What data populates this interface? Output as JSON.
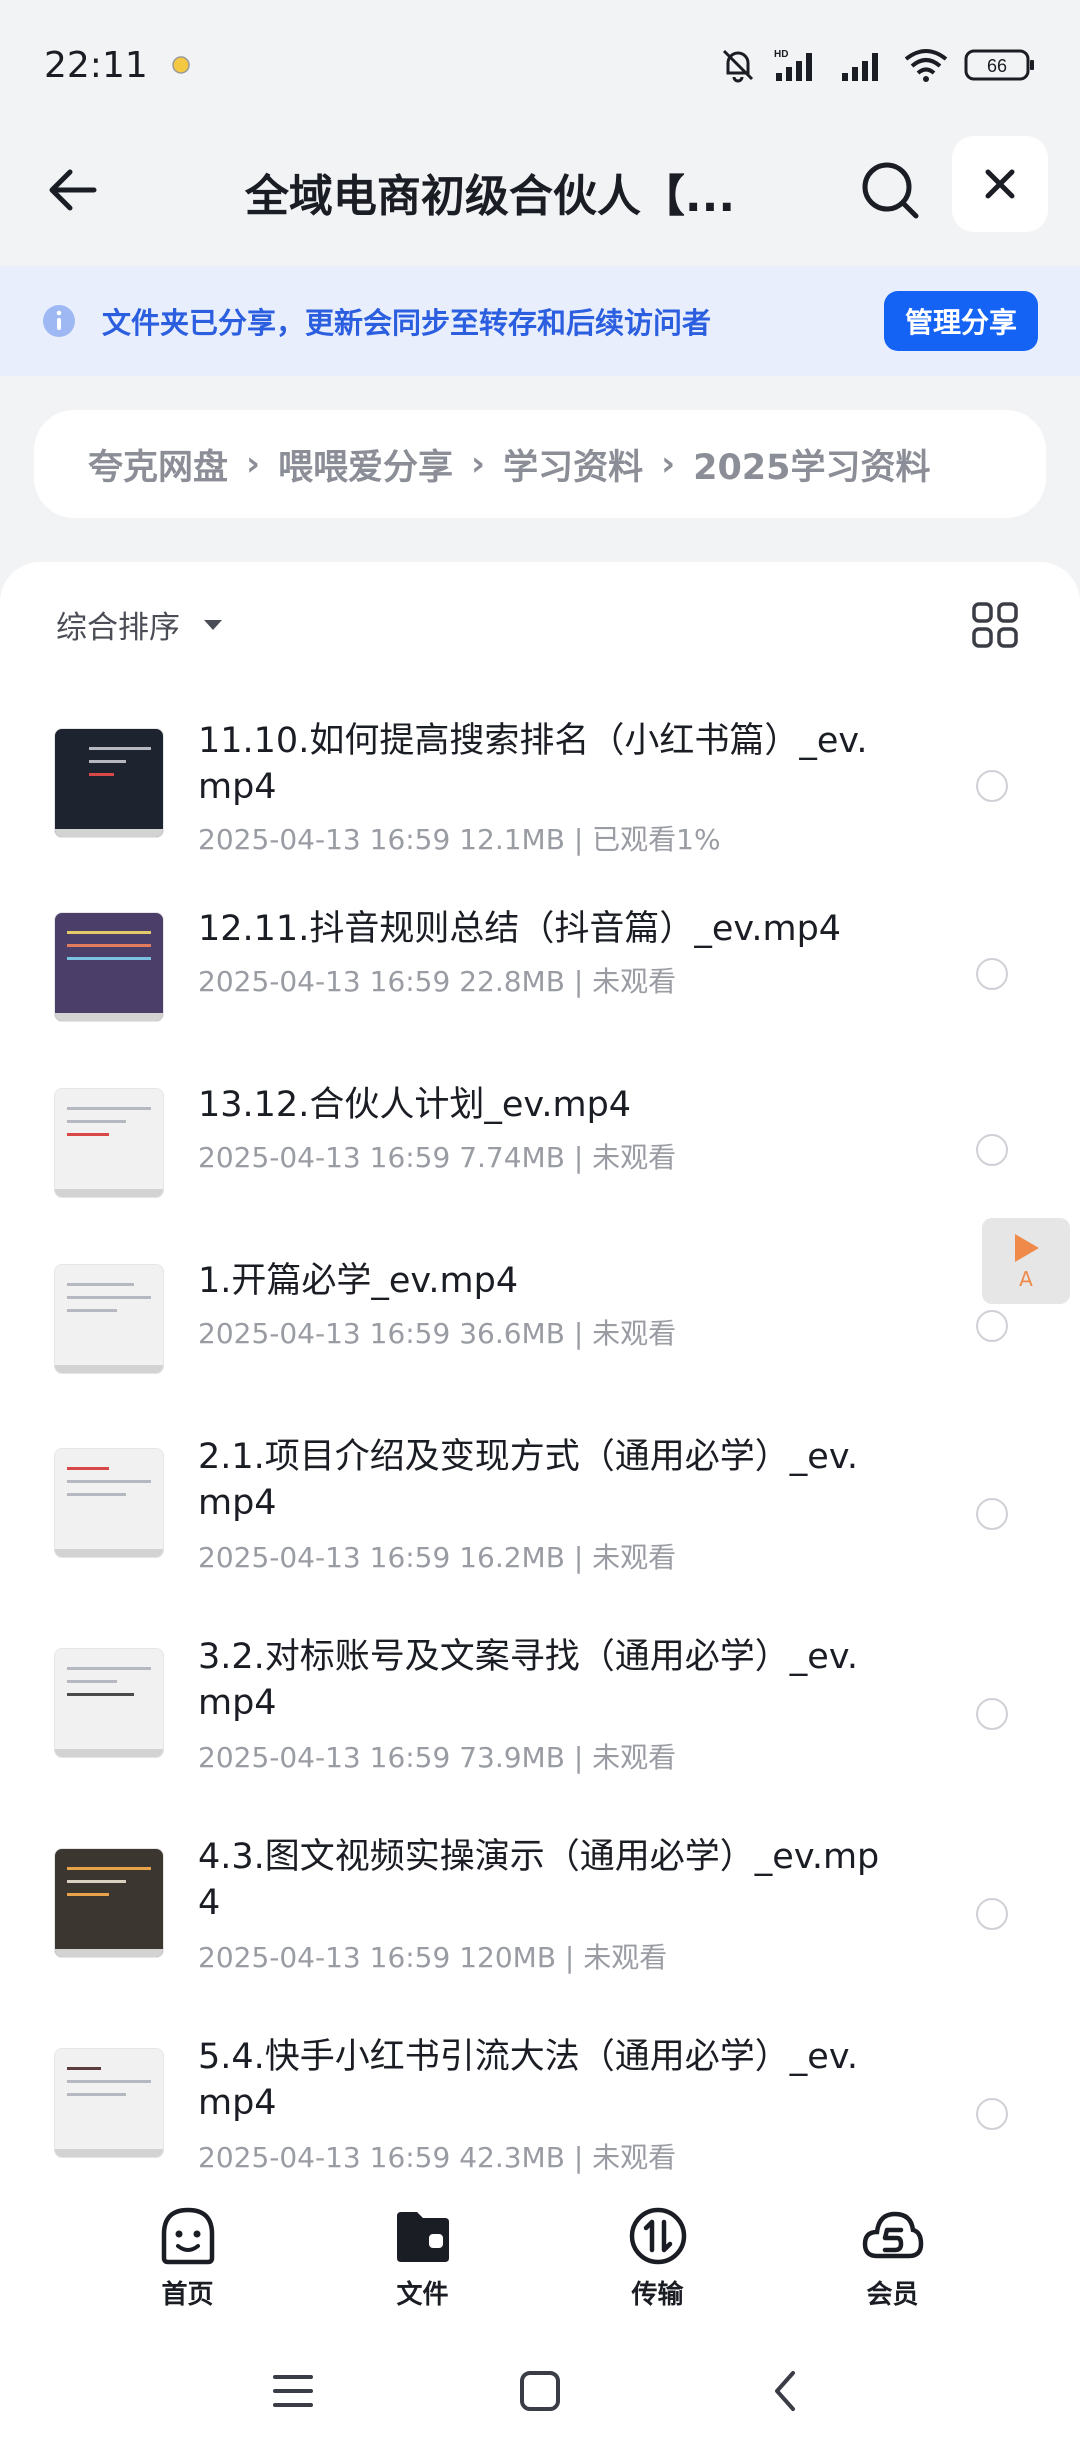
{
  "status": {
    "time": "22:11",
    "battery": "66"
  },
  "header": {
    "title": "全域电商初级合伙人【..."
  },
  "banner": {
    "text": "文件夹已分享，更新会同步至转存和后续访问者",
    "manage_label": "管理分享"
  },
  "breadcrumb": [
    "夸克网盘",
    "喂喂爱分享",
    "学习资料",
    "2025学习资料"
  ],
  "sort": {
    "label": "综合排序"
  },
  "files": [
    {
      "name": "11.10.如何提高搜索排名（小红书篇）_ev.mp4",
      "meta": "2025-04-13 16:59  12.1MB | 已观看1%"
    },
    {
      "name": "12.11.抖音规则总结（抖音篇）_ev.mp4",
      "meta": "2025-04-13 16:59  22.8MB | 未观看"
    },
    {
      "name": "13.12.合伙人计划_ev.mp4",
      "meta": "2025-04-13 16:59  7.74MB | 未观看"
    },
    {
      "name": "1.开篇必学_ev.mp4",
      "meta": "2025-04-13 16:59  36.6MB | 未观看"
    },
    {
      "name": "2.1.项目介绍及变现方式（通用必学）_ev.mp4",
      "meta": "2025-04-13 16:59  16.2MB | 未观看"
    },
    {
      "name": "3.2.对标账号及文案寻找（通用必学）_ev.mp4",
      "meta": "2025-04-13 16:59  73.9MB | 未观看"
    },
    {
      "name": "4.3.图文视频实操演示（通用必学）_ev.mp4",
      "meta": "2025-04-13 16:59  120MB | 未观看"
    },
    {
      "name": "5.4.快手小红书引流大法（通用必学）_ev.mp4",
      "meta": "2025-04-13 16:59  42.3MB | 未观看"
    }
  ],
  "float_button": {
    "label": "A"
  },
  "nav": [
    {
      "label": "首页",
      "icon": "home-smile-icon"
    },
    {
      "label": "文件",
      "icon": "folder-icon"
    },
    {
      "label": "传输",
      "icon": "transfer-icon"
    },
    {
      "label": "会员",
      "icon": "vip-cloud-icon"
    }
  ],
  "colors": {
    "accent": "#1463f5",
    "banner_bg": "#e8eefc",
    "banner_text": "#2c5fe0"
  }
}
